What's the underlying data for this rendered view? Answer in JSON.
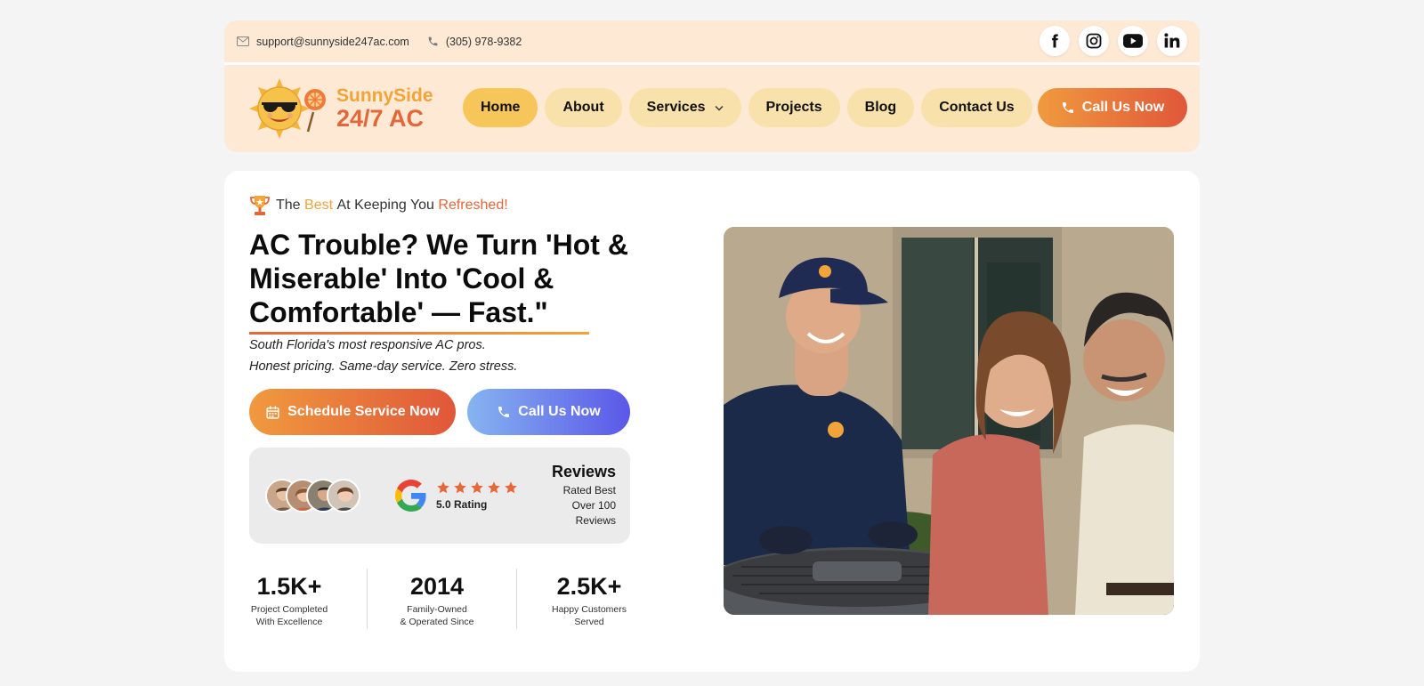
{
  "topbar": {
    "email": "support@sunnyside247ac.com",
    "phone": "(305) 978-9382",
    "socials": [
      "facebook-icon",
      "instagram-icon",
      "youtube-icon",
      "linkedin-icon"
    ]
  },
  "brand": {
    "line1": "SunnySide",
    "line2": "24/7 AC",
    "colors": {
      "yellow": "#f0a43a",
      "orange": "#e2673a",
      "header_bg": "#fde9d4",
      "nav_pill": "#f8e1ab",
      "nav_active": "#f6c65a"
    }
  },
  "nav": {
    "items": [
      {
        "label": "Home",
        "active": true
      },
      {
        "label": "About"
      },
      {
        "label": "Services",
        "dropdown": true
      },
      {
        "label": "Projects"
      },
      {
        "label": "Blog"
      },
      {
        "label": "Contact Us"
      }
    ],
    "call_label": "Call Us Now"
  },
  "hero": {
    "tagline": {
      "pre": "The",
      "best": "Best",
      "mid": "At Keeping You",
      "refreshed": "Refreshed!"
    },
    "headline": "AC Trouble? We Turn 'Hot & Miserable' Into 'Cool & Comfortable' — Fast.\"",
    "sub1": "South Florida's most responsive AC pros.",
    "sub2": "Honest pricing. Same-day service. Zero stress.",
    "schedule_label": "Schedule Service Now",
    "call_label": "Call Us Now"
  },
  "reviews": {
    "rating_text": "5.0 Rating",
    "stars": 5,
    "title": "Reviews",
    "subtitle": "Rated Best Over 100 Reviews"
  },
  "stats": [
    {
      "value": "1.5K+",
      "label1": "Project Completed",
      "label2": "With Excellence"
    },
    {
      "value": "2014",
      "label1": "Family-Owned",
      "label2": "& Operated Since"
    },
    {
      "value": "2.5K+",
      "label1": "Happy Customers",
      "label2": "Served"
    }
  ]
}
